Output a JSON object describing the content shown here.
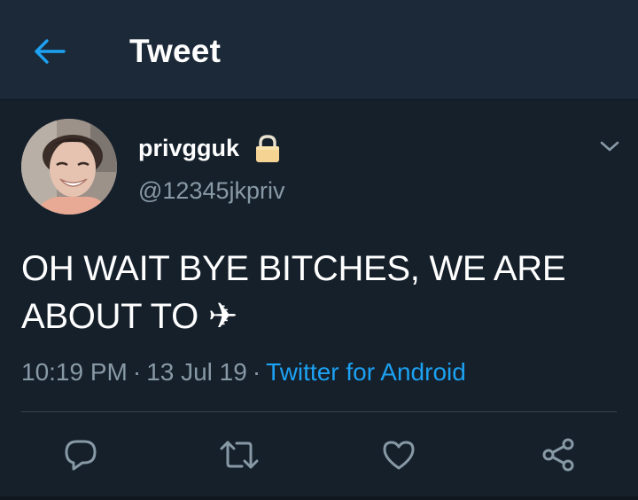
{
  "header": {
    "title": "Tweet",
    "back_icon": "arrow-left-icon"
  },
  "tweet": {
    "display_name": "privgguk",
    "handle": "@12345jkpriv",
    "protected_icon": "lock-icon",
    "text_line1": "OH WAIT BYE BITCHES, WE ARE",
    "text_line2": "ABOUT TO",
    "text_emoji": "✈",
    "time": "10:19 PM",
    "date": "13 Jul 19",
    "separator": "·",
    "source": "Twitter for Android"
  },
  "actions": [
    "reply-icon",
    "retweet-icon",
    "like-icon",
    "share-icon"
  ],
  "colors": {
    "background": "#15202b",
    "header_background": "#1c2938",
    "accent": "#1da1f2",
    "secondary_text": "#8899a6",
    "divider": "#38444d",
    "lock": "#f5d393"
  }
}
